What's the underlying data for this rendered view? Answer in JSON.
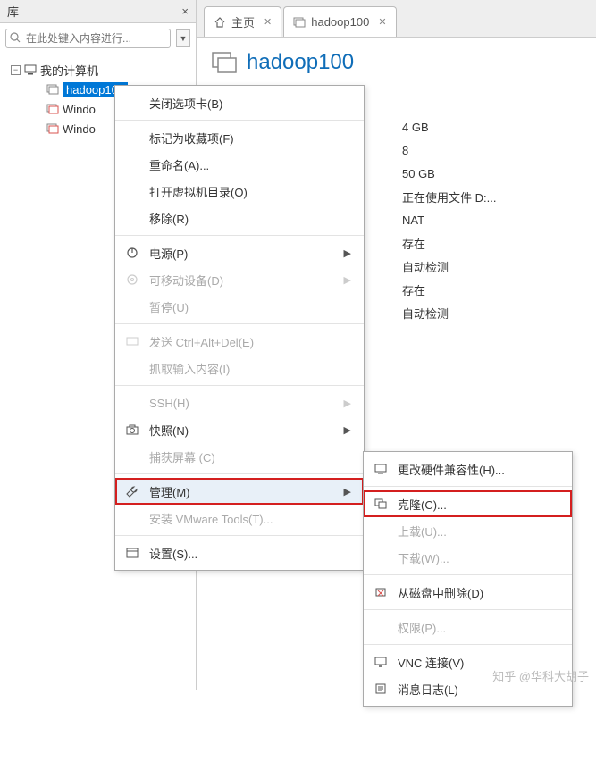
{
  "sidebar": {
    "title": "库",
    "search_placeholder": "在此处键入内容进行...",
    "tree": {
      "root_label": "我的计算机",
      "items": [
        {
          "label": "hadoop100",
          "selected": true
        },
        {
          "label": "Windo"
        },
        {
          "label": "Windo"
        }
      ]
    }
  },
  "tabs": {
    "home": "主页",
    "vm": "hadoop100"
  },
  "vm": {
    "title": "hadoop100",
    "details": {
      "memory": "4 GB",
      "cpu": "8",
      "disk": "50 GB",
      "using_file": "正在使用文件 D:...",
      "network": "NAT",
      "exists1": "存在",
      "auto_detect1": "自动检测",
      "exists2": "存在",
      "auto_detect2": "自动检测"
    }
  },
  "context_menu": {
    "close_tab": "关闭选项卡(B)",
    "favorite": "标记为收藏项(F)",
    "rename": "重命名(A)...",
    "open_dir": "打开虚拟机目录(O)",
    "remove": "移除(R)",
    "power": "电源(P)",
    "removable": "可移动设备(D)",
    "pause": "暂停(U)",
    "send_cad": "发送 Ctrl+Alt+Del(E)",
    "grab_input": "抓取输入内容(I)",
    "ssh": "SSH(H)",
    "snapshot": "快照(N)",
    "capture": "捕获屏幕 (C)",
    "manage": "管理(M)",
    "install_tools": "安装 VMware Tools(T)...",
    "settings": "设置(S)..."
  },
  "submenu": {
    "hw_compat": "更改硬件兼容性(H)...",
    "clone": "克隆(C)...",
    "upload": "上载(U)...",
    "download": "下载(W)...",
    "delete_disk": "从磁盘中删除(D)",
    "permissions": "权限(P)...",
    "vnc": "VNC 连接(V)",
    "message_log": "消息日志(L)"
  },
  "watermark": "知乎 @华科大胡子"
}
